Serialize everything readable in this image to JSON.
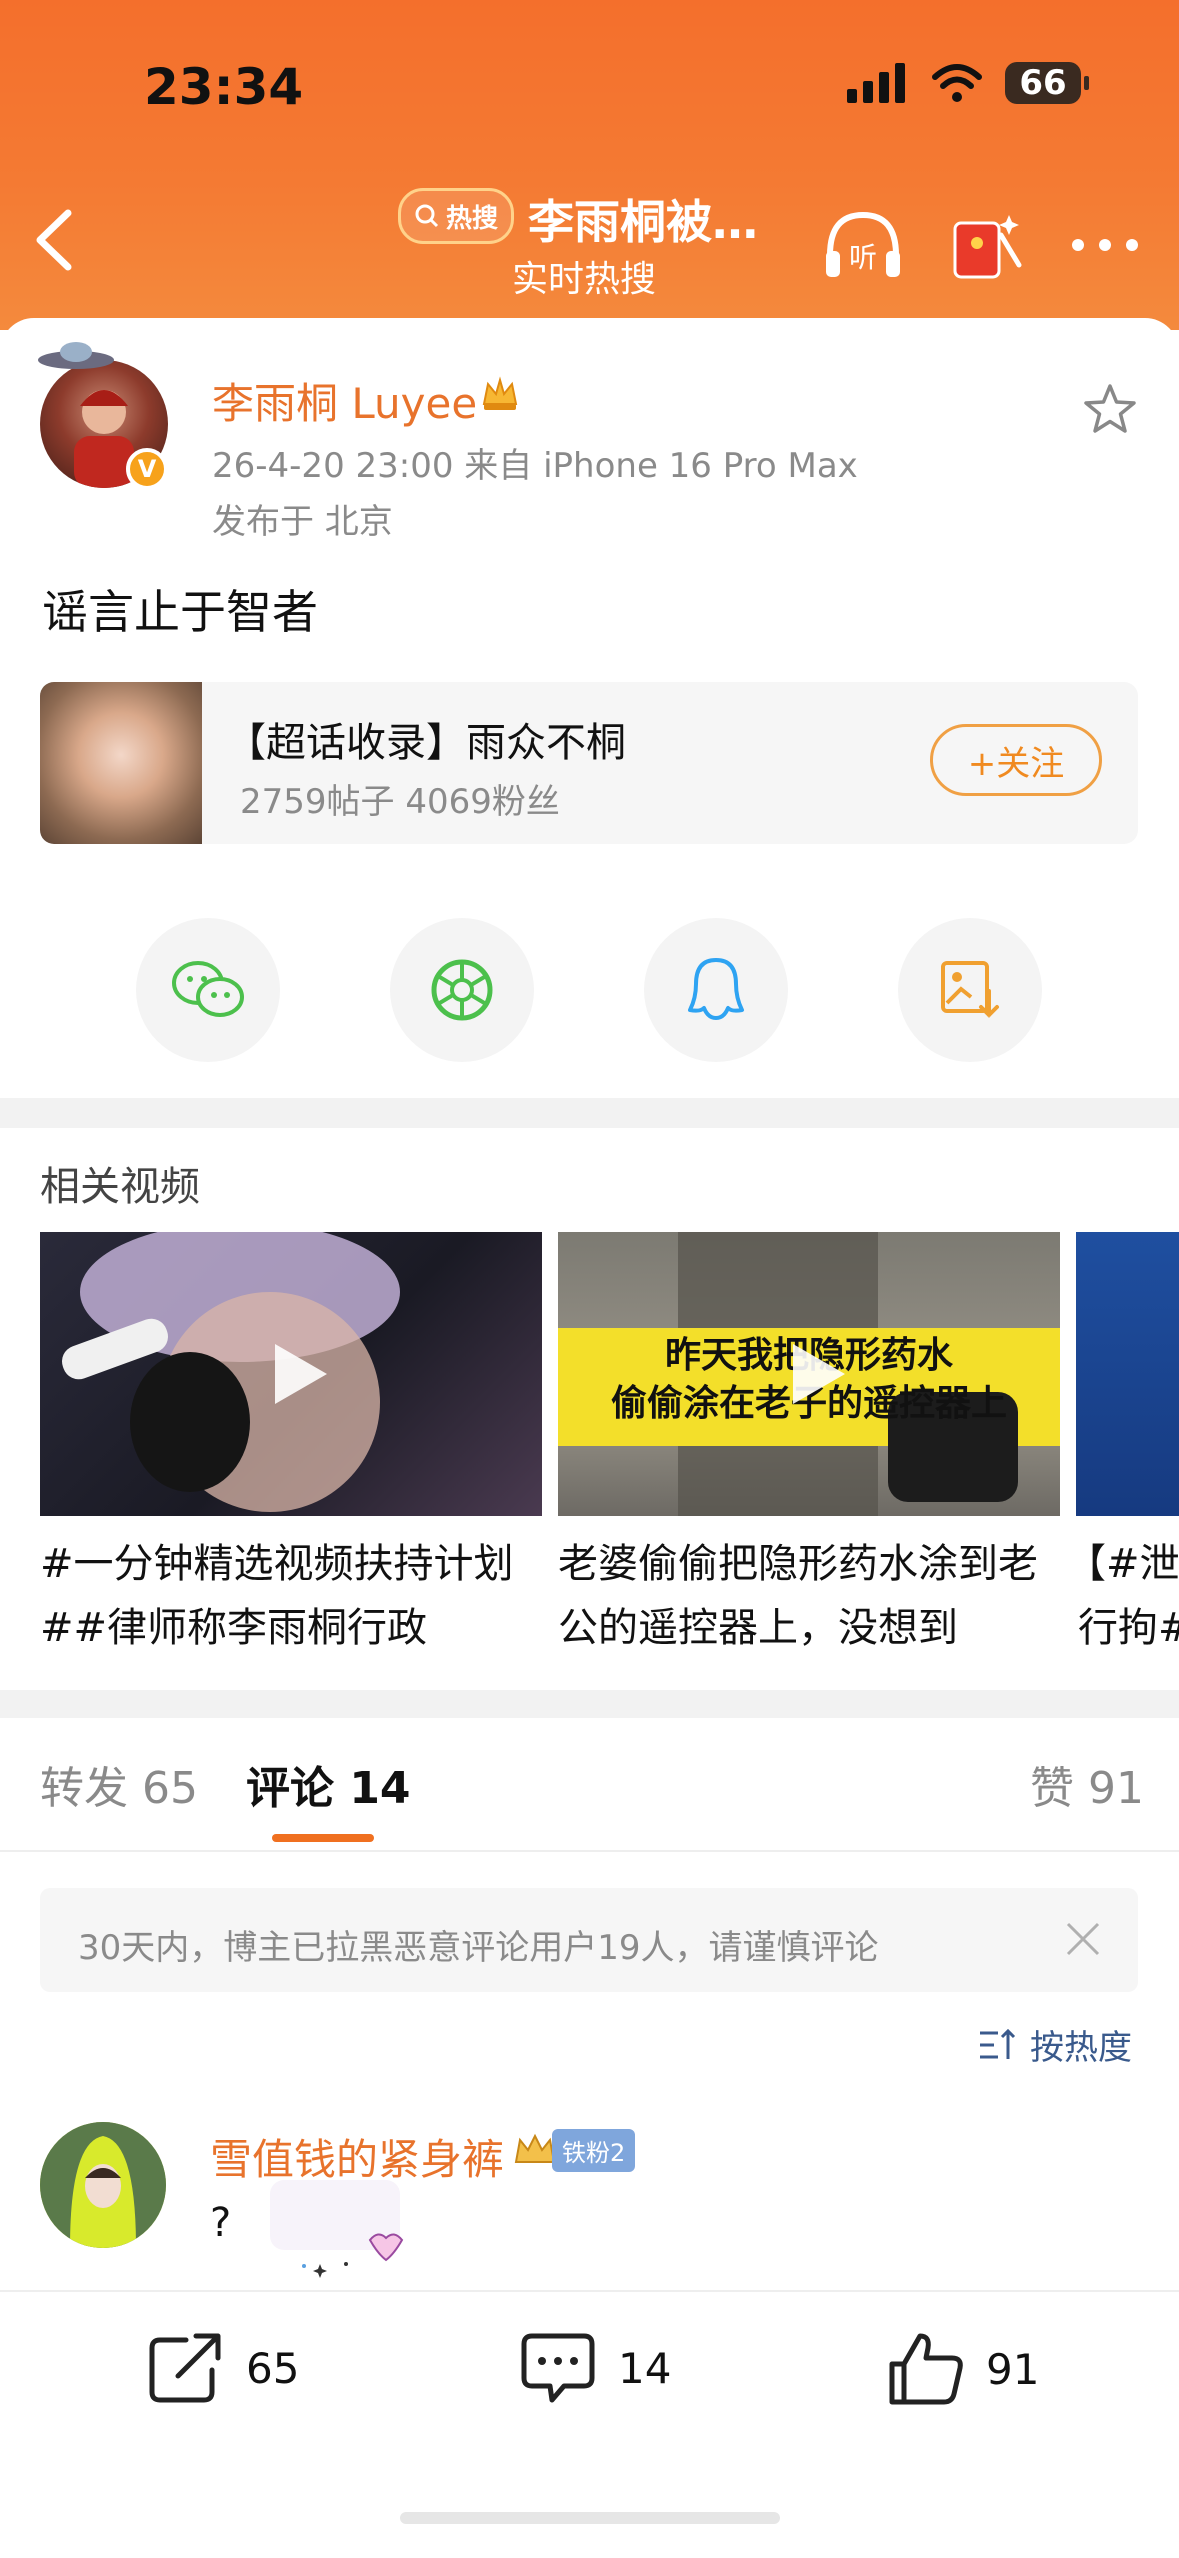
{
  "status_bar": {
    "time": "23:34",
    "battery": "66"
  },
  "header": {
    "hot_badge": "热搜",
    "title": "李雨桐被…",
    "subtitle": "实时热搜",
    "listen_label": "听"
  },
  "post": {
    "author": "李雨桐 Luyee",
    "meta": "26-4-20 23:00  来自 iPhone 16 Pro Max",
    "location": "发布于 北京",
    "verified_label": "V",
    "text": "谣言止于智者"
  },
  "supertopic": {
    "title": "【超话收录】雨众不桐",
    "stats": "2759帖子 4069粉丝",
    "follow_label": "+关注"
  },
  "share": {
    "items": [
      "wechat",
      "moments",
      "qq",
      "save-image"
    ]
  },
  "related_videos": {
    "title": "相关视频",
    "items": [
      {
        "caption_line1": "#一分钟精选视频扶持计划",
        "caption_line2": "##律师称李雨桐行政"
      },
      {
        "overlay_line1": "昨天我把隐形药水",
        "overlay_line2": "偷偷涂在老子的遥控器上",
        "caption_line1": "老婆偷偷把隐形药水涂到老",
        "caption_line2": "公的遥控器上，没想到"
      },
      {
        "caption_line1": "【#泄露",
        "caption_line2": "行拘#"
      }
    ]
  },
  "tabs": {
    "repost": "转发 65",
    "comments": "评论 14",
    "likes": "赞 91"
  },
  "notice": {
    "text": "30天内，博主已拉黑恶意评论用户19人，请谨慎评论"
  },
  "sort": {
    "label": "按热度"
  },
  "comment": {
    "user": "雪值钱的紧身裤",
    "badge": "铁粉2",
    "text": "?"
  },
  "bottom_bar": {
    "repost_count": "65",
    "comment_count": "14",
    "like_count": "91"
  },
  "colors": {
    "header_orange": "#f47a33",
    "accent_orange": "#e8732c",
    "follow_orange": "#f08a20",
    "sort_blue": "#3a5a8c"
  }
}
